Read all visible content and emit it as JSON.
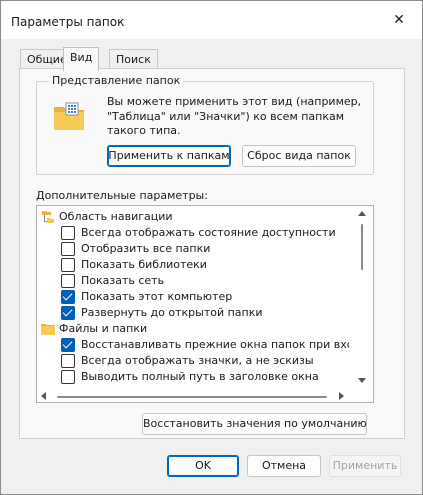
{
  "window": {
    "title": "Параметры папок",
    "close_glyph": "✕"
  },
  "tabs": [
    {
      "label": "Общие",
      "active": false
    },
    {
      "label": "Вид",
      "active": true
    },
    {
      "label": "Поиск",
      "active": false
    }
  ],
  "folder_view": {
    "legend": "Представление папок",
    "description": "Вы можете применить этот вид (например, \"Таблица\" или \"Значки\") ко всем папкам такого типа.",
    "apply_button": "Применить к папкам",
    "reset_button": "Сброс вида папок"
  },
  "advanced": {
    "label": "Дополнительные параметры:",
    "items": [
      {
        "type": "group",
        "icon": "navigation-pane-icon",
        "label": "Область навигации"
      },
      {
        "type": "checkbox",
        "checked": false,
        "label": "Всегда отображать состояние доступности"
      },
      {
        "type": "checkbox",
        "checked": false,
        "label": "Отобразить все папки"
      },
      {
        "type": "checkbox",
        "checked": false,
        "label": "Показать библиотеки"
      },
      {
        "type": "checkbox",
        "checked": false,
        "label": "Показать сеть"
      },
      {
        "type": "checkbox",
        "checked": true,
        "label": "Показать этот компьютер"
      },
      {
        "type": "checkbox",
        "checked": true,
        "label": "Развернуть до открытой папки"
      },
      {
        "type": "group",
        "icon": "folder-icon",
        "label": "Файлы и папки"
      },
      {
        "type": "checkbox",
        "checked": true,
        "label": "Восстанавливать прежние окна папок при входе в си"
      },
      {
        "type": "checkbox",
        "checked": false,
        "label": "Всегда отображать значки, а не эскизы"
      },
      {
        "type": "checkbox",
        "checked": false,
        "label": "Выводить полный путь в заголовке окна"
      }
    ]
  },
  "restore_defaults_button": "Восстановить значения по умолчанию",
  "footer": {
    "ok": "OK",
    "cancel": "Отмена",
    "apply": "Применить"
  },
  "colors": {
    "accent": "#005fb8",
    "window_bg": "#f0f0f0",
    "panel_bg": "#f9f9f9"
  }
}
